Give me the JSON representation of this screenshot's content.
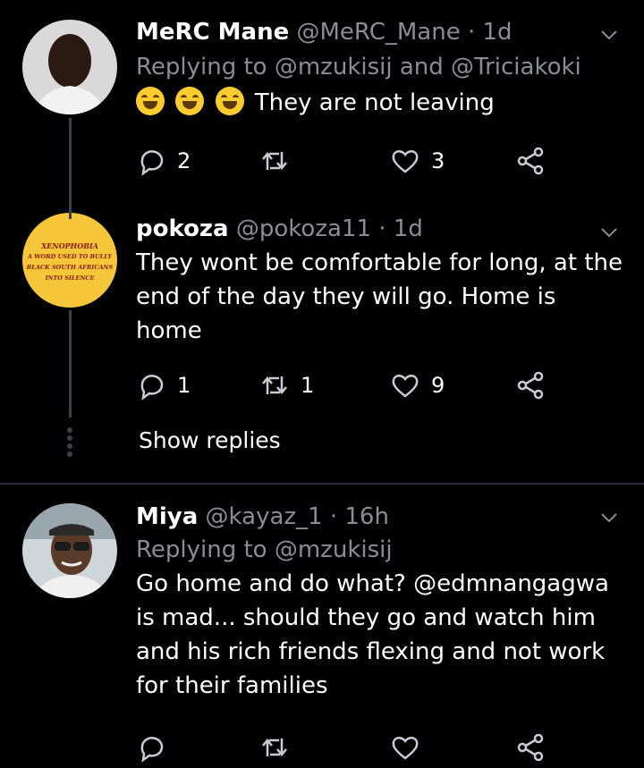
{
  "tweets": [
    {
      "name": "MeRC Mane",
      "handle": "@MeRC_Mane",
      "time": "· 1d",
      "reply_prefix": "Replying to",
      "reply_mentions": "@mzukisij and @Triciakoki",
      "emojis": [
        "joy",
        "rofl",
        "joy"
      ],
      "text": "They are not leaving",
      "replies": "2",
      "retweets": "",
      "likes": "3"
    },
    {
      "name": "pokoza",
      "handle": "@pokoza11",
      "time": "· 1d",
      "avatar_text": [
        "XENOPHOBIA",
        "A WORD USED TO BULLY",
        "BLACK SOUTH AFRICANS",
        "INTO SILENCE"
      ],
      "text": "They wont be comfortable for long, at the end of the day they will go. Home is home",
      "replies": "1",
      "retweets": "1",
      "likes": "9",
      "show_replies": "Show replies"
    },
    {
      "name": "Miya",
      "handle": "@kayaz_1",
      "time": "· 16h",
      "reply_prefix": "Replying to",
      "reply_mentions": "@mzukisij",
      "text": "Go home and do what? @edmnangagwa is mad... should they go and watch him and his rich friends flexing and not work for their families",
      "replies": "",
      "retweets": "",
      "likes": ""
    }
  ],
  "colors": {
    "background": "#000000",
    "muted_text": "#8a8d91",
    "thread_line": "#3d4044",
    "divider": "#2a2d31"
  },
  "icons": [
    "chevron-down-icon",
    "reply-icon",
    "retweet-icon",
    "like-icon",
    "share-icon"
  ]
}
